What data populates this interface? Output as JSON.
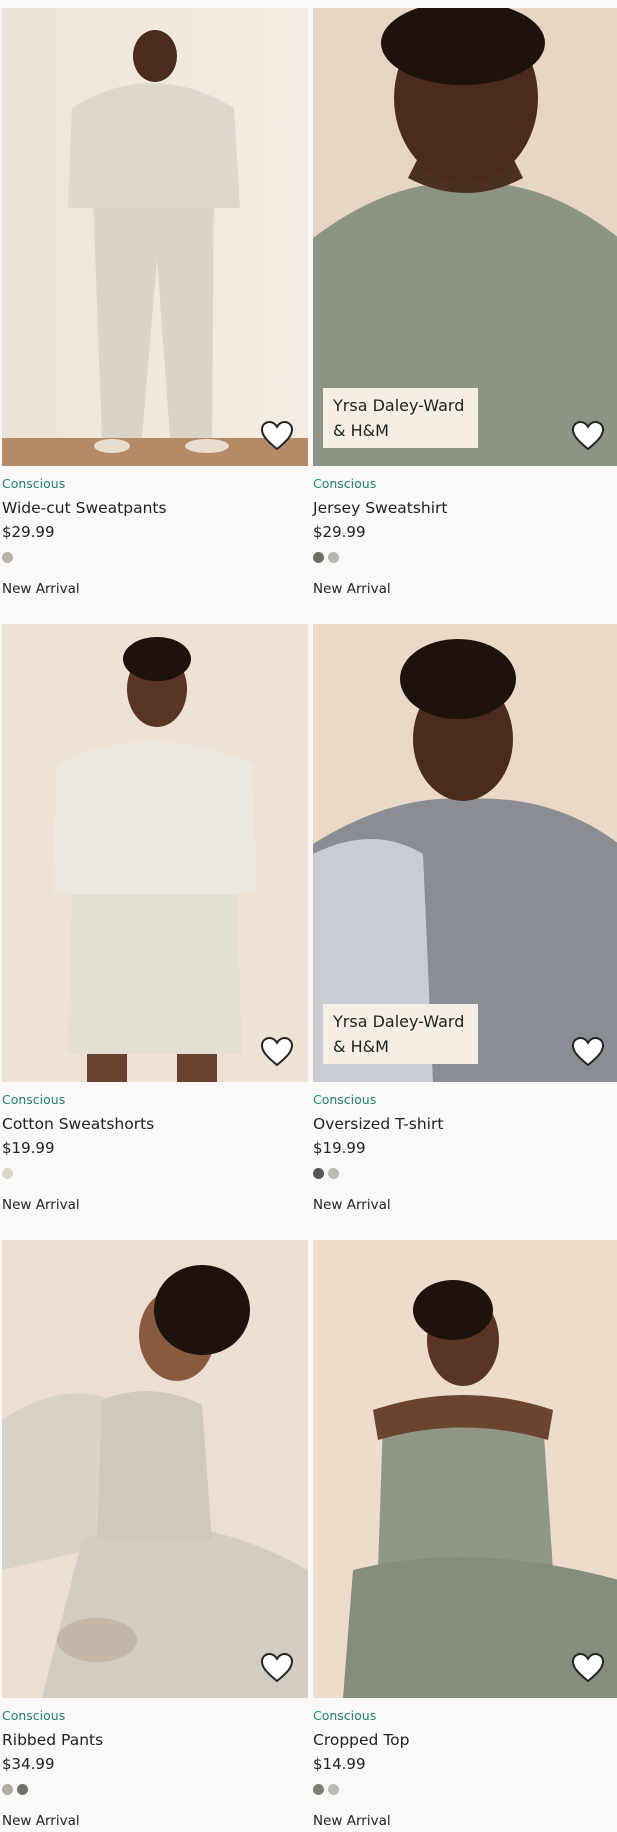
{
  "products": [
    {
      "tag": "Conscious",
      "name": "Wide-cut Sweatpants",
      "price": "$29.99",
      "swatches": [
        "#b7b3aa"
      ],
      "status": "New Arrival",
      "badge": "",
      "image": "woman-in-beige-sweatsuit"
    },
    {
      "tag": "Conscious",
      "name": "Jersey Sweatshirt",
      "price": "$29.99",
      "swatches": [
        "#6e6f64",
        "#b9b5ad"
      ],
      "status": "New Arrival",
      "badge": "Yrsa Daley-Ward & H&M",
      "image": "woman-in-sage-sweatshirt"
    },
    {
      "tag": "Conscious",
      "name": "Cotton Sweatshorts",
      "price": "$19.99",
      "swatches": [
        "#d9d8c8"
      ],
      "status": "New Arrival",
      "badge": "",
      "image": "woman-in-cream-sweatshorts"
    },
    {
      "tag": "Conscious",
      "name": "Oversized T-shirt",
      "price": "$19.99",
      "swatches": [
        "#55565a",
        "#bdb9b3"
      ],
      "status": "New Arrival",
      "badge": "Yrsa Daley-Ward & H&M",
      "image": "woman-in-grey-tshirt"
    },
    {
      "tag": "Conscious",
      "name": "Ribbed Pants",
      "price": "$34.99",
      "swatches": [
        "#b0ada5",
        "#6d7268"
      ],
      "status": "New Arrival",
      "badge": "",
      "image": "woman-in-ribbed-pants"
    },
    {
      "tag": "Conscious",
      "name": "Cropped Top",
      "price": "$14.99",
      "swatches": [
        "#7d7f72",
        "#bdbab2"
      ],
      "status": "New Arrival",
      "badge": "",
      "image": "woman-in-cropped-top"
    }
  ],
  "colors": {
    "accent": "#1e7f70",
    "badge_bg": "#f4eee4",
    "page_bg": "#faf9f8"
  }
}
